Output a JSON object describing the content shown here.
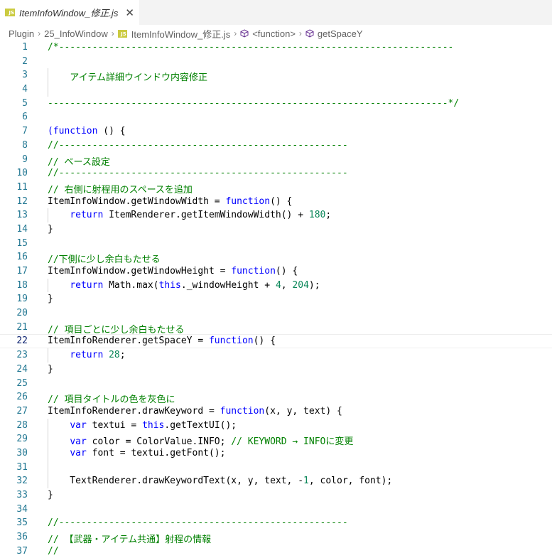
{
  "tab": {
    "badge": "JS",
    "title": "ItemInfoWindow_修正.js",
    "close": "✕"
  },
  "breadcrumb": [
    "Plugin",
    "25_InfoWindow",
    "ItemInfoWindow_修正.js",
    "<function>",
    "getSpaceY"
  ],
  "current_line": 22,
  "colors": {
    "comment": "#008000",
    "keyword": "#0000ff",
    "number": "#098658",
    "line_number": "#237893",
    "badge": "#cbcb41"
  },
  "lines": [
    {
      "n": "1",
      "t": [
        [
          "c",
          "/*-----------------------------------------------------------------------"
        ]
      ]
    },
    {
      "n": "2",
      "t": []
    },
    {
      "n": "3",
      "t": [
        [
          "c",
          "    アイテム詳細ウインドウ内容修正"
        ]
      ]
    },
    {
      "n": "4",
      "t": []
    },
    {
      "n": "5",
      "t": [
        [
          "c",
          "------------------------------------------------------------------------*/"
        ]
      ]
    },
    {
      "n": "6",
      "t": []
    },
    {
      "n": "7",
      "t": [
        [
          "k",
          "(function"
        ],
        [
          "m",
          " () {"
        ]
      ]
    },
    {
      "n": "8",
      "t": [
        [
          "c",
          "//----------------------------------------------------"
        ]
      ]
    },
    {
      "n": "9",
      "t": [
        [
          "c",
          "// ベース設定"
        ]
      ]
    },
    {
      "n": "10",
      "t": [
        [
          "c",
          "//----------------------------------------------------"
        ]
      ]
    },
    {
      "n": "11",
      "t": [
        [
          "c",
          "// 右側に射程用のスペースを追加"
        ]
      ]
    },
    {
      "n": "12",
      "t": [
        [
          "m",
          "ItemInfoWindow.getWindowWidth = "
        ],
        [
          "k",
          "function"
        ],
        [
          "m",
          "() {"
        ]
      ]
    },
    {
      "n": "13",
      "t": [
        [
          "m",
          "    "
        ],
        [
          "k",
          "return"
        ],
        [
          "m",
          " ItemRenderer.getItemWindowWidth() + "
        ],
        [
          "n",
          "180"
        ],
        [
          "m",
          ";"
        ]
      ]
    },
    {
      "n": "14",
      "t": [
        [
          "m",
          "}"
        ]
      ]
    },
    {
      "n": "15",
      "t": []
    },
    {
      "n": "16",
      "t": [
        [
          "c",
          "//下側に少し余白もたせる"
        ]
      ]
    },
    {
      "n": "17",
      "t": [
        [
          "m",
          "ItemInfoWindow.getWindowHeight = "
        ],
        [
          "k",
          "function"
        ],
        [
          "m",
          "() {"
        ]
      ]
    },
    {
      "n": "18",
      "t": [
        [
          "m",
          "    "
        ],
        [
          "k",
          "return"
        ],
        [
          "m",
          " Math.max("
        ],
        [
          "k",
          "this"
        ],
        [
          "m",
          "._windowHeight + "
        ],
        [
          "n",
          "4"
        ],
        [
          "m",
          ", "
        ],
        [
          "n",
          "204"
        ],
        [
          "m",
          ");"
        ]
      ]
    },
    {
      "n": "19",
      "t": [
        [
          "m",
          "}"
        ]
      ]
    },
    {
      "n": "20",
      "t": []
    },
    {
      "n": "21",
      "t": [
        [
          "c",
          "// 項目ごとに少し余白もたせる"
        ]
      ]
    },
    {
      "n": "22",
      "t": [
        [
          "m",
          "ItemInfoRenderer.getSpaceY = "
        ],
        [
          "k",
          "function"
        ],
        [
          "m",
          "() {"
        ]
      ]
    },
    {
      "n": "23",
      "t": [
        [
          "m",
          "    "
        ],
        [
          "k",
          "return"
        ],
        [
          "m",
          " "
        ],
        [
          "n",
          "28"
        ],
        [
          "m",
          ";"
        ]
      ]
    },
    {
      "n": "24",
      "t": [
        [
          "m",
          "}"
        ]
      ]
    },
    {
      "n": "25",
      "t": []
    },
    {
      "n": "26",
      "t": [
        [
          "c",
          "// 項目タイトルの色を灰色に"
        ]
      ]
    },
    {
      "n": "27",
      "t": [
        [
          "m",
          "ItemInfoRenderer.drawKeyword = "
        ],
        [
          "k",
          "function"
        ],
        [
          "m",
          "(x, y, text) {"
        ]
      ]
    },
    {
      "n": "28",
      "t": [
        [
          "m",
          "    "
        ],
        [
          "k",
          "var"
        ],
        [
          "m",
          " textui = "
        ],
        [
          "k",
          "this"
        ],
        [
          "m",
          ".getTextUI();"
        ]
      ]
    },
    {
      "n": "29",
      "t": [
        [
          "m",
          "    "
        ],
        [
          "k",
          "var"
        ],
        [
          "m",
          " color = ColorValue.INFO; "
        ],
        [
          "c",
          "// KEYWORD → INFOに変更"
        ]
      ]
    },
    {
      "n": "30",
      "t": [
        [
          "m",
          "    "
        ],
        [
          "k",
          "var"
        ],
        [
          "m",
          " font = textui.getFont();"
        ]
      ]
    },
    {
      "n": "31",
      "t": []
    },
    {
      "n": "32",
      "t": [
        [
          "m",
          "    TextRenderer.drawKeywordText(x, y, text, -"
        ],
        [
          "n",
          "1"
        ],
        [
          "m",
          ", color, font);"
        ]
      ]
    },
    {
      "n": "33",
      "t": [
        [
          "m",
          "}"
        ]
      ]
    },
    {
      "n": "34",
      "t": []
    },
    {
      "n": "35",
      "t": [
        [
          "c",
          "//----------------------------------------------------"
        ]
      ]
    },
    {
      "n": "36",
      "t": [
        [
          "c",
          "// 【武器・アイテム共通】射程の情報"
        ]
      ]
    },
    {
      "n": "37",
      "t": [
        [
          "c",
          "//"
        ]
      ]
    }
  ]
}
